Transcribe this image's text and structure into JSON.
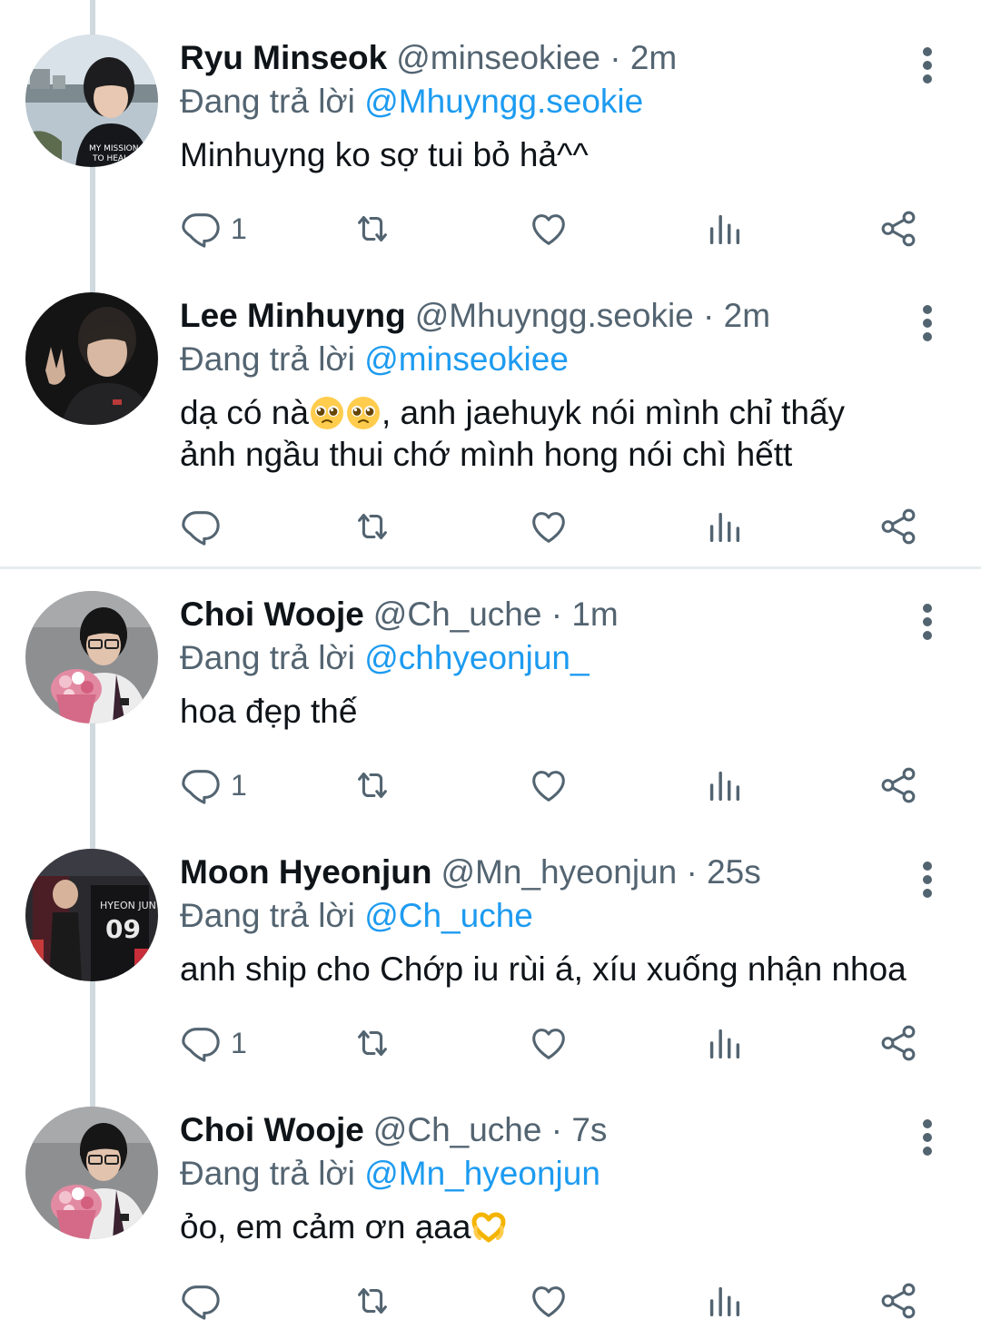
{
  "colors": {
    "link": "#1d9bf0",
    "secondary_text": "#536471",
    "primary_text": "#0f1419",
    "thread_line": "#cfd9de"
  },
  "tweets": [
    {
      "name": "Ryu Minseok",
      "handle": "@minseokiee",
      "time": "2m",
      "replying_label": "Đang trả lời",
      "replying_to": "@Mhuyngg.seokie",
      "text": "Minhuyng ko sợ tui bỏ hả^^",
      "reply_count": "1"
    },
    {
      "name": "Lee Minhuyng",
      "handle": "@Mhuyngg.seokie",
      "time": "2m",
      "replying_label": "Đang trả lời",
      "replying_to": "@minseokiee",
      "text_part1": "dạ có nà",
      "text_part2": ", anh jaehuyk nói mình chỉ thấy",
      "text_line2": "ảnh ngầu thui chớ mình hong nói chì hếtt",
      "reply_count": ""
    },
    {
      "name": "Choi Wooje",
      "handle": "@Ch_uche",
      "time": "1m",
      "replying_label": "Đang trả lời",
      "replying_to": "@chhyeonjun_",
      "text": "hoa đẹp thế",
      "reply_count": "1"
    },
    {
      "name": "Moon Hyeonjun",
      "handle": "@Mn_hyeonjun",
      "time": "25s",
      "replying_label": "Đang trả lời",
      "replying_to": "@Ch_uche",
      "text": "anh ship cho Chớp iu rùi á, xíu xuống nhận nhoa",
      "reply_count": "1"
    },
    {
      "name": "Choi Wooje",
      "handle": "@Ch_uche",
      "time": "7s",
      "replying_label": "Đang trả lời",
      "replying_to": "@Mn_hyeonjun",
      "text": "ỏo, em cảm ơn ạaa",
      "reply_count": ""
    }
  ],
  "icons": {
    "reply": "reply-icon",
    "retweet": "retweet-icon",
    "like": "heart-icon",
    "views": "views-icon",
    "share": "share-icon",
    "more": "more-vertical-icon",
    "pleading_emoji": "pleading-face-emoji",
    "heart_hands_emoji": "heart-hands-emoji"
  }
}
